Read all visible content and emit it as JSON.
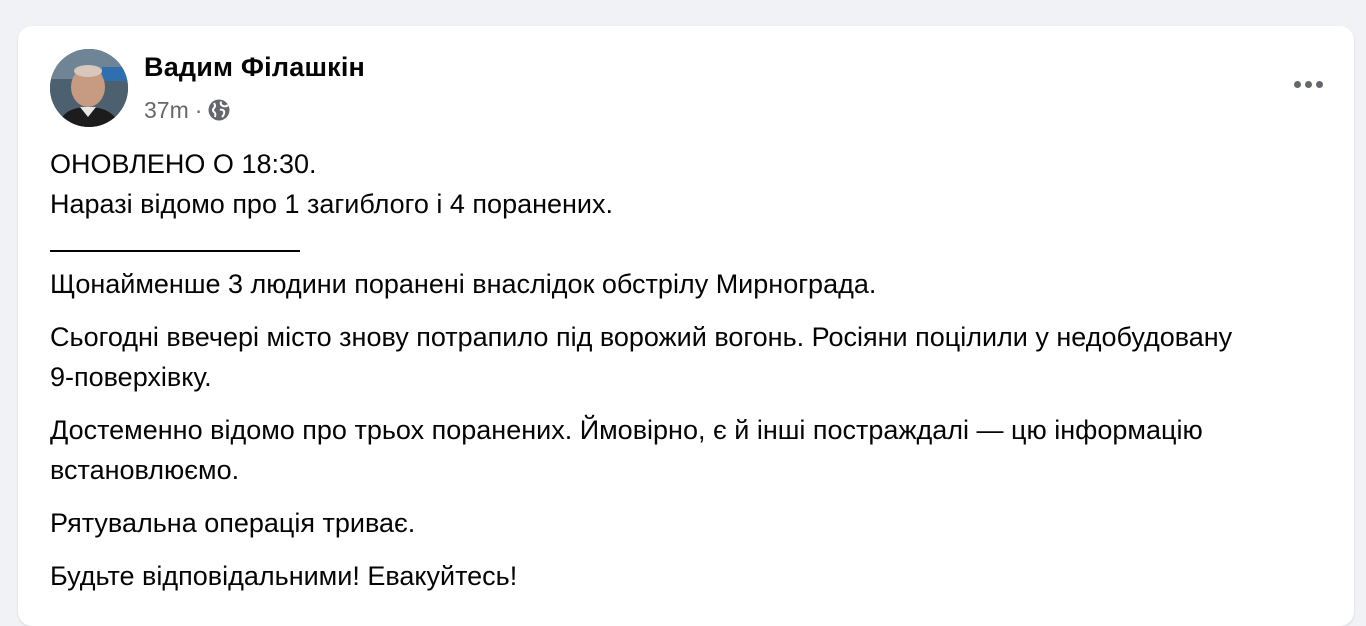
{
  "post": {
    "author": "Вадим Філашкін",
    "time": "37m",
    "separator_dot": "·",
    "audience_icon": "globe-icon",
    "more_icon": "more-options-icon",
    "paragraphs": [
      "ОНОВЛЕНО О 18:30.",
      "Наразі відомо про 1 загиблого і 4 поранених.",
      "Щонайменше 3 людини поранені внаслідок обстрілу Мирнограда.",
      "Сьогодні ввечері місто знову потрапило під ворожий вогонь. Росіяни поцілили у недобудовану 9-поверхівку.",
      "Достеменно відомо про трьох поранених. Ймовірно, є й інші постраждалі — цю інформацію встановлюємо.",
      "Рятувальна операція триває.",
      "Будьте відповідальними! Евакуйтесь!"
    ]
  },
  "colors": {
    "page_bg": "#f0f2f5",
    "card_bg": "#ffffff",
    "text": "#050505",
    "secondary_text": "#65676b"
  }
}
